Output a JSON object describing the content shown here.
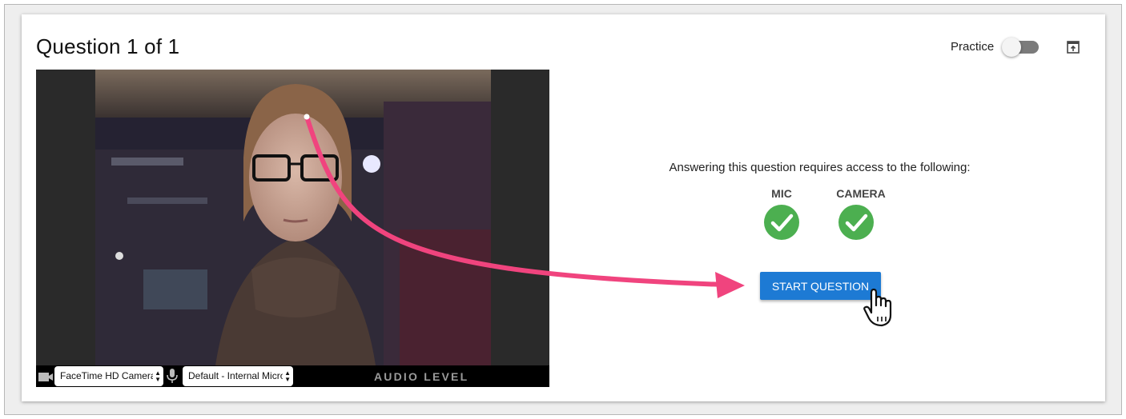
{
  "header": {
    "title": "Question 1 of 1",
    "practice_label": "Practice",
    "practice_enabled": false
  },
  "video": {
    "camera_select": "FaceTime HD Camera",
    "mic_select": "Default - Internal Microphone",
    "audio_level_label": "AUDIO LEVEL"
  },
  "permissions": {
    "requires_text": "Answering this question requires access to the following:",
    "mic_label": "MIC",
    "camera_label": "CAMERA",
    "check_color": "#4caf50"
  },
  "actions": {
    "start_label": "START QUESTION",
    "button_color": "#1d7ad4",
    "annotation_arrow_color": "#f0447e"
  }
}
